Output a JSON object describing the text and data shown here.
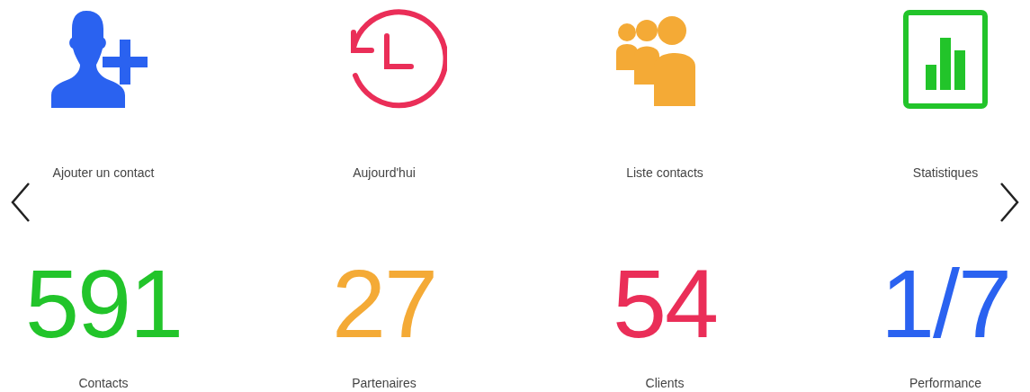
{
  "shortcuts": [
    {
      "kind": "add-contact",
      "label": "Ajouter un contact",
      "color": "#2a62f0"
    },
    {
      "kind": "history",
      "label": "Aujourd'hui",
      "color": "#ea2e58"
    },
    {
      "kind": "group",
      "label": "Liste contacts",
      "color": "#f4aa36"
    },
    {
      "kind": "chart",
      "label": "Statistiques",
      "color": "#22c42a"
    }
  ],
  "stats": [
    {
      "value": "591",
      "label": "Contacts",
      "color": "#22c42a"
    },
    {
      "value": "27",
      "label": "Partenaires",
      "color": "#f4aa36"
    },
    {
      "value": "54",
      "label": "Clients",
      "color": "#ea2e58"
    },
    {
      "value": "1/7",
      "label": "Performance",
      "color": "#2a62f0"
    }
  ]
}
